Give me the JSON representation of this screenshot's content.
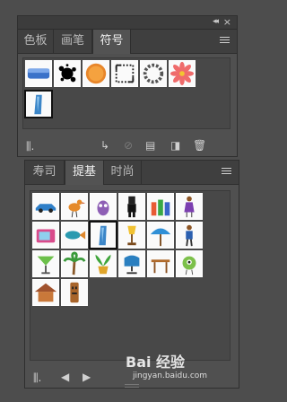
{
  "symbols_panel": {
    "tabs": [
      {
        "label": "色板"
      },
      {
        "label": "画笔"
      },
      {
        "label": "符号"
      }
    ],
    "active_tab": "符号",
    "symbols": [
      {
        "name": "blue-banner"
      },
      {
        "name": "ink-splatter"
      },
      {
        "name": "orange-button"
      },
      {
        "name": "dotted-frame"
      },
      {
        "name": "chain-wreath"
      },
      {
        "name": "pink-flower"
      },
      {
        "name": "blue-figure"
      }
    ],
    "footer_icons": [
      "library-icon",
      "place-symbol-icon",
      "break-link-icon",
      "symbol-options-icon",
      "new-symbol-icon",
      "delete-icon"
    ]
  },
  "library_panel": {
    "tabs": [
      {
        "label": "寿司"
      },
      {
        "label": "提基"
      },
      {
        "label": "时尚"
      }
    ],
    "active_tab": "提基",
    "symbols": [
      {
        "name": "blue-car"
      },
      {
        "name": "orange-bird"
      },
      {
        "name": "purple-creature"
      },
      {
        "name": "tiki-man"
      },
      {
        "name": "colored-drums"
      },
      {
        "name": "woman-figure"
      },
      {
        "name": "tv-set"
      },
      {
        "name": "teal-fish"
      },
      {
        "name": "blue-figure"
      },
      {
        "name": "yellow-lamp"
      },
      {
        "name": "beach-umbrella"
      },
      {
        "name": "man-figure"
      },
      {
        "name": "green-cocktail"
      },
      {
        "name": "palm-tree"
      },
      {
        "name": "potted-plant"
      },
      {
        "name": "blue-chair"
      },
      {
        "name": "wooden-table"
      },
      {
        "name": "green-alien"
      },
      {
        "name": "tiki-hut"
      },
      {
        "name": "tiki-statue"
      }
    ],
    "footer_icons": [
      "library-icon",
      "previous-icon",
      "next-icon"
    ]
  },
  "watermark": {
    "title": "Bai 经验",
    "url": "jingyan.baidu.com"
  }
}
